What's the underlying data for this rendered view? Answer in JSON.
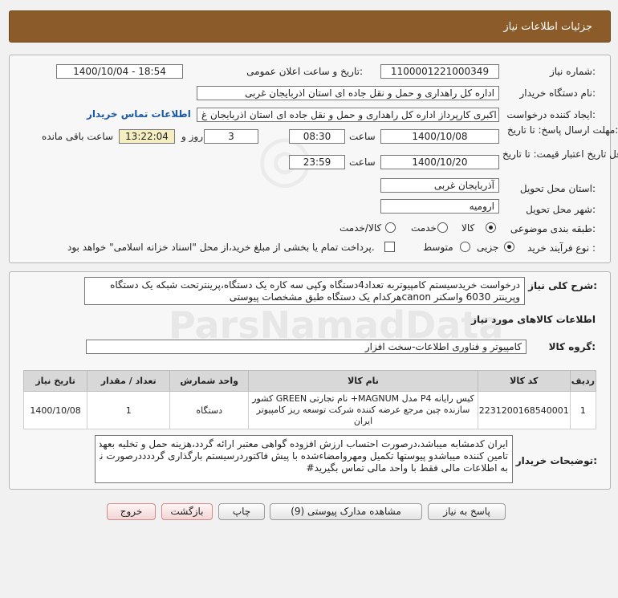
{
  "header": {
    "title": "جزئیات اطلاعات نیاز"
  },
  "form": {
    "need_number": {
      "label": "شماره نیاز:",
      "value": "1100001221000349"
    },
    "announce_datetime": {
      "label": "تاریخ و ساعت اعلان عمومی:",
      "value": "1400/10/04 - 18:54"
    },
    "buyer_org": {
      "label": "نام دستگاه خریدار:",
      "value": "اداره کل راهداری و حمل و نقل جاده ای استان اذربایجان غربی"
    },
    "requester": {
      "label": "ایجاد کننده درخواست:",
      "value": "مهدی اکبری کارپرداز اداره کل راهداری و حمل و نقل جاده ای استان اذربایجان غ",
      "contact_link": "اطلاعات تماس خریدار"
    },
    "response_deadline": {
      "label": "مهلت ارسال پاسخ: تا تاریخ:",
      "date": "1400/10/08",
      "time_label": "ساعت",
      "time": "08:30",
      "days": "3",
      "days_label": "روز و",
      "remaining": "13:22:04",
      "remaining_label": "ساعت باقی مانده"
    },
    "price_validity": {
      "label": "حداقل تاریخ اعتبار قیمت: تا تاریخ:",
      "date": "1400/10/20",
      "time_label": "ساعت",
      "time": "23:59"
    },
    "delivery_province": {
      "label": "استان محل تحویل:",
      "value": "آذربایجان غربی"
    },
    "delivery_city": {
      "label": "شهر محل تحویل:",
      "value": "ارومیه"
    },
    "category": {
      "label": "طبقه بندی موضوعی:",
      "options": [
        "کالا",
        "خدمت",
        "کالا/خدمت"
      ],
      "selected": "کالا"
    },
    "purchase_type": {
      "label": "نوع فرآیند خرید :",
      "options": [
        "جزیی",
        "متوسط"
      ],
      "selected": "جزیی",
      "payment_note": "پرداخت تمام یا بخشی از مبلغ خرید،از محل \"اسناد خزانه اسلامی\" خواهد بود."
    }
  },
  "description": {
    "label": "شرح کلی نیاز:",
    "lines": [
      "درخواست خریدسیستم کامپیوتربه تعداد4دستگاه وکپی سه کاره یک دستگاه،پرینترتحت شبکه یک دستگاه",
      "وپرینتر 6030 واسکنر canonهرکدام یک دستگاه طبق مشخصات پیوستی"
    ]
  },
  "goods": {
    "section_title": "اطلاعات کالاهای مورد نیاز",
    "group_label": "گروه کالا:",
    "group_value": "کامپیوتر و فناوری اطلاعات-سخت افزار",
    "columns": [
      "ردیف",
      "کد کالا",
      "نام کالا",
      "واحد شمارش",
      "تعداد / مقدار",
      "تاریخ نیاز"
    ],
    "rows": [
      {
        "row": "1",
        "code": "2231200168540001",
        "name_lines": [
          "کیس رایانه P4 مدل MAGNUM+ نام تجارتی GREEN کشور",
          "سازنده چین مرجع عرضه کننده شرکت توسعه ریز کامپیوتر",
          "ایران"
        ],
        "unit": "دستگاه",
        "qty": "1",
        "date": "1400/10/08"
      }
    ]
  },
  "buyer_notes": {
    "label": "توضیحات خریدار:",
    "lines": [
      "ایران کدمشابه میباشد،درصورت احتساب ارزش افزوده گواهی معتبر ارائه گردد،هزینه حمل و تخلیه بعهده",
      "تامین کننده میباشدو پیوستها تکمیل ومهروامضاءشده با پیش فاکتوردرسیستم بارگذاری گرددددرصورت نیاز",
      "به اطلاعات مالی فقط با واحد مالی تماس بگیرید#"
    ]
  },
  "buttons": {
    "reply": "پاسخ به نیاز",
    "attachments": "مشاهده مدارک پیوستی (9)",
    "print": "چاپ",
    "back": "بازگشت",
    "exit": "خروج"
  }
}
